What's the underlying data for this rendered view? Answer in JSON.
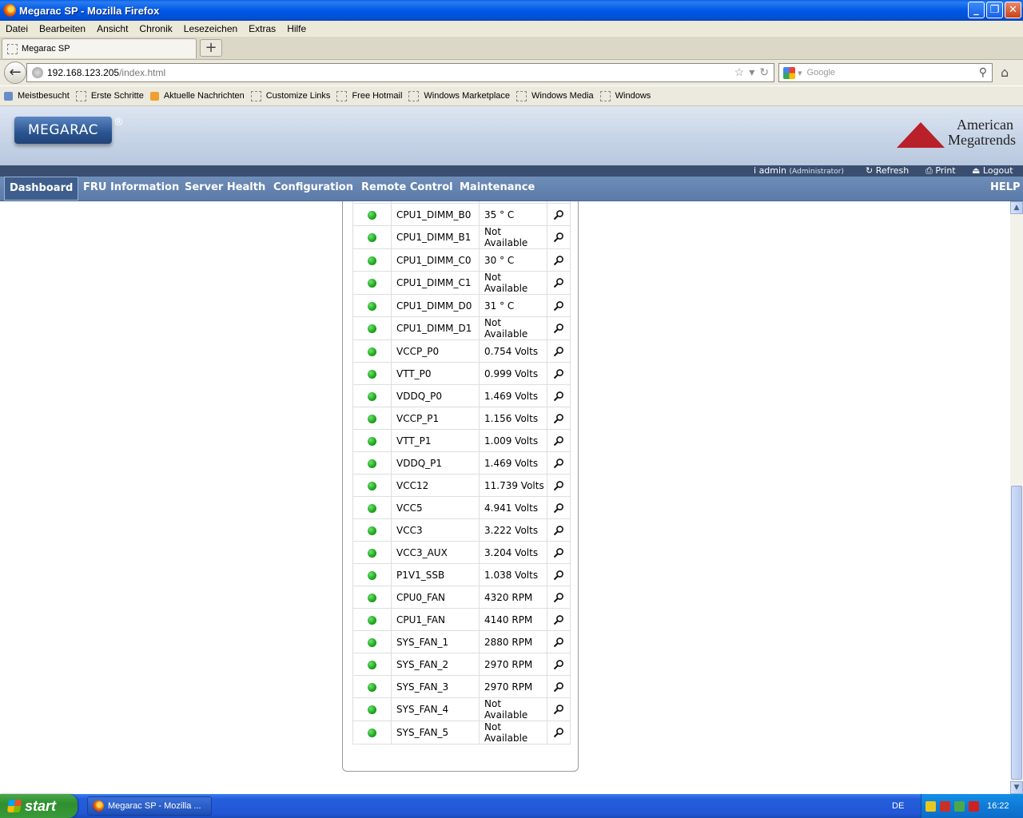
{
  "window": {
    "title": "Megarac SP - Mozilla Firefox",
    "min": "_",
    "max": "❐",
    "close": "✕"
  },
  "menu": [
    "Datei",
    "Bearbeiten",
    "Ansicht",
    "Chronik",
    "Lesezeichen",
    "Extras",
    "Hilfe"
  ],
  "tab": {
    "label": "Megarac SP",
    "new_tab": "+"
  },
  "nav": {
    "back": "←",
    "url_host": "192.168.123.205",
    "url_path": "/index.html",
    "search_placeholder": "Google",
    "star": "☆",
    "dropdown": "▾",
    "reload": "↻",
    "home": "⌂",
    "search_icon": "⚲"
  },
  "bookmarks": [
    "Meistbesucht",
    "Erste Schritte",
    "Aktuelle Nachrichten",
    "Customize Links",
    "Free Hotmail",
    "Windows Marketplace",
    "Windows Media",
    "Windows"
  ],
  "header": {
    "logo": "MEGARAC",
    "reg": "®",
    "brand_line1": "American",
    "brand_line2": "Megatrends"
  },
  "userbar": {
    "user": "admin",
    "role": "(Administrator)",
    "refresh": "Refresh",
    "print": "Print",
    "logout": "Logout"
  },
  "mainnav": {
    "items": [
      "Dashboard",
      "FRU Information",
      "Server Health",
      "Configuration",
      "Remote Control",
      "Maintenance"
    ],
    "help": "HELP",
    "active": "Dashboard"
  },
  "sensors": [
    {
      "name": "CPU1_DIMM_B0",
      "value": "35 ° C"
    },
    {
      "name": "CPU1_DIMM_B1",
      "value": "Not Available"
    },
    {
      "name": "CPU1_DIMM_C0",
      "value": "30 ° C"
    },
    {
      "name": "CPU1_DIMM_C1",
      "value": "Not Available"
    },
    {
      "name": "CPU1_DIMM_D0",
      "value": "31 ° C"
    },
    {
      "name": "CPU1_DIMM_D1",
      "value": "Not Available"
    },
    {
      "name": "VCCP_P0",
      "value": "0.754 Volts"
    },
    {
      "name": "VTT_P0",
      "value": "0.999 Volts"
    },
    {
      "name": "VDDQ_P0",
      "value": "1.469 Volts"
    },
    {
      "name": "VCCP_P1",
      "value": "1.156 Volts"
    },
    {
      "name": "VTT_P1",
      "value": "1.009 Volts"
    },
    {
      "name": "VDDQ_P1",
      "value": "1.469 Volts"
    },
    {
      "name": "VCC12",
      "value": "11.739 Volts"
    },
    {
      "name": "VCC5",
      "value": "4.941 Volts"
    },
    {
      "name": "VCC3",
      "value": "3.222 Volts"
    },
    {
      "name": "VCC3_AUX",
      "value": "3.204 Volts"
    },
    {
      "name": "P1V1_SSB",
      "value": "1.038 Volts"
    },
    {
      "name": "CPU0_FAN",
      "value": "4320 RPM"
    },
    {
      "name": "CPU1_FAN",
      "value": "4140 RPM"
    },
    {
      "name": "SYS_FAN_1",
      "value": "2880 RPM"
    },
    {
      "name": "SYS_FAN_2",
      "value": "2970 RPM"
    },
    {
      "name": "SYS_FAN_3",
      "value": "2970 RPM"
    },
    {
      "name": "SYS_FAN_4",
      "value": "Not Available"
    },
    {
      "name": "SYS_FAN_5",
      "value": "Not Available"
    }
  ],
  "status_color": "#1a9e1a",
  "scrollbar": {
    "up": "▲",
    "down": "▼"
  },
  "taskbar": {
    "start": "start",
    "task": "Megarac SP - Mozilla ...",
    "lang": "DE",
    "clock": "16:22"
  }
}
